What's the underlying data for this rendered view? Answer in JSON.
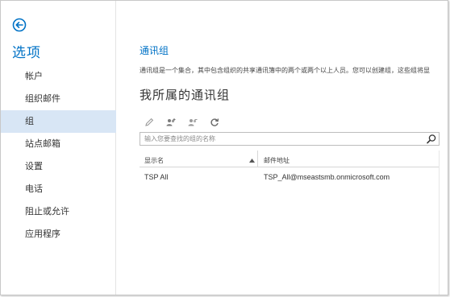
{
  "sidebar": {
    "title": "选项",
    "items": [
      {
        "label": "帐户"
      },
      {
        "label": "组织邮件"
      },
      {
        "label": "组",
        "selected": true
      },
      {
        "label": "站点邮箱"
      },
      {
        "label": "设置"
      },
      {
        "label": "电话"
      },
      {
        "label": "阻止或允许"
      },
      {
        "label": "应用程序"
      }
    ]
  },
  "main": {
    "section_title": "通讯组",
    "description": "通讯组是一个集合，其中包含组织的共享通讯簿中的两个或两个以上人员。您可以创建组，这些组将显",
    "heading": "我所属的通讯组",
    "toolbar": {
      "icons": [
        "edit-icon",
        "join-group-icon",
        "leave-group-icon",
        "refresh-icon"
      ]
    },
    "search": {
      "placeholder": "输入您要查找的组的名称",
      "value": ""
    },
    "table": {
      "columns": [
        "显示名",
        "邮件地址"
      ],
      "sort": "ascending",
      "rows": [
        {
          "name": "TSP All",
          "email": "TSP_All@mseastsmb.onmicrosoft.com"
        }
      ]
    }
  },
  "colors": {
    "accent": "#0072c6",
    "selected_bg": "#d8e6f5",
    "text": "#333333"
  }
}
